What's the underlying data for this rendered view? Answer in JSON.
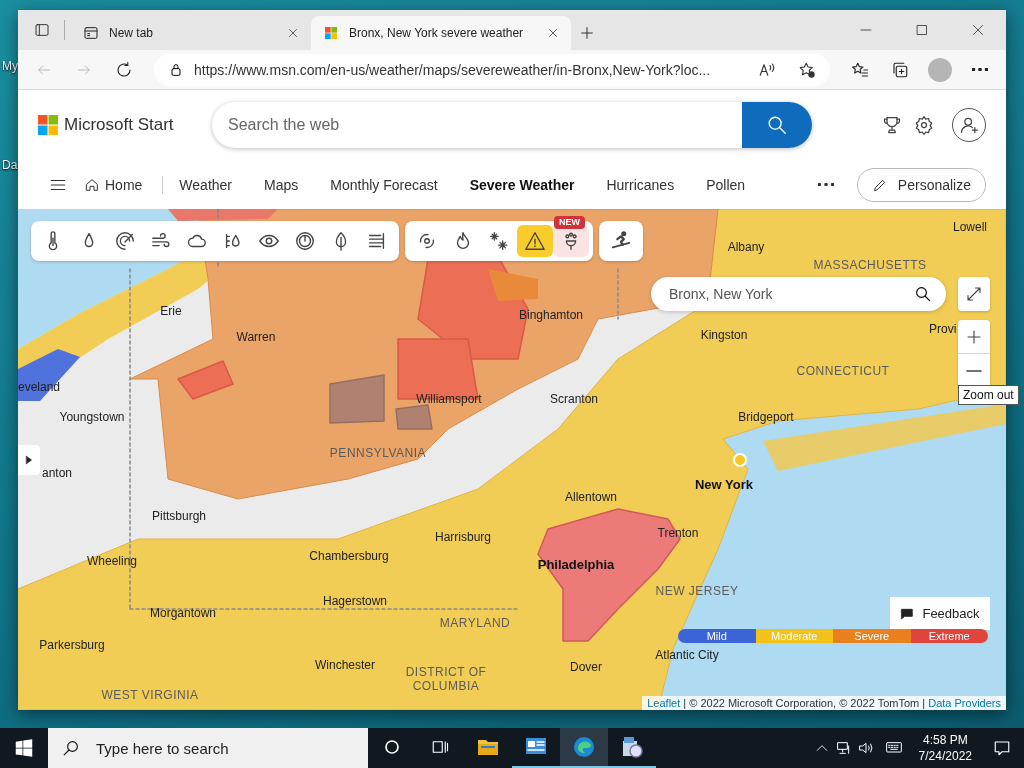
{
  "desktop": {
    "icon_labels": [
      "My",
      "Da"
    ]
  },
  "browser": {
    "tabs": [
      {
        "title": "New tab",
        "selected": false
      },
      {
        "title": "Bronx, New York severe weather",
        "selected": true
      }
    ],
    "url": "https://www.msn.com/en-us/weather/maps/severeweather/in-Bronx,New-York?loc..."
  },
  "site": {
    "logo": "Microsoft Start",
    "search": {
      "placeholder": "Search the web"
    },
    "nav": [
      {
        "label": "Home",
        "kind": "home",
        "selected": false
      },
      {
        "label": "Weather",
        "kind": "link",
        "selected": false
      },
      {
        "label": "Maps",
        "kind": "link",
        "selected": false
      },
      {
        "label": "Monthly Forecast",
        "kind": "link",
        "selected": false
      },
      {
        "label": "Severe Weather",
        "kind": "link",
        "selected": true
      },
      {
        "label": "Hurricanes",
        "kind": "link",
        "selected": false
      },
      {
        "label": "Pollen",
        "kind": "link",
        "selected": false
      }
    ],
    "personalize": "Personalize"
  },
  "map": {
    "layer_groups": [
      [
        {
          "kind": "temperature",
          "selected": false
        },
        {
          "kind": "precipitation",
          "selected": false
        },
        {
          "kind": "radar",
          "selected": false
        },
        {
          "kind": "wind",
          "selected": false
        },
        {
          "kind": "cloud",
          "selected": false
        },
        {
          "kind": "humidity",
          "selected": false
        },
        {
          "kind": "visibility",
          "selected": false
        },
        {
          "kind": "pressure",
          "selected": false
        },
        {
          "kind": "pollen",
          "selected": false
        },
        {
          "kind": "air",
          "selected": false
        }
      ],
      [
        {
          "kind": "hurricane",
          "selected": false
        },
        {
          "kind": "fire",
          "selected": false
        },
        {
          "kind": "snow",
          "selected": false
        },
        {
          "kind": "alert",
          "selected": true
        },
        {
          "kind": "flower",
          "selected": false,
          "badge": "NEW"
        }
      ],
      [
        {
          "kind": "ski",
          "selected": false
        }
      ]
    ],
    "search": {
      "value": "Bronx, New York"
    },
    "tooltip": "Zoom out",
    "feedback": "Feedback",
    "legend": [
      {
        "label": "Mild",
        "color": "#3b64d6"
      },
      {
        "label": "Moderate",
        "color": "#f2c21b"
      },
      {
        "label": "Severe",
        "color": "#e8801e"
      },
      {
        "label": "Extreme",
        "color": "#e0443a"
      }
    ],
    "attribution": {
      "link_1": "Leaflet",
      "text": "| © 2022 Microsoft Corporation, © 2022 TomTom |",
      "link_2": "Data Providers"
    },
    "labels": [
      {
        "text": "Albany",
        "kind": "city"
      },
      {
        "text": "Lowell",
        "kind": "city"
      },
      {
        "text": "MASSACHUSETTS",
        "kind": "state"
      },
      {
        "text": "Erie",
        "kind": "city"
      },
      {
        "text": "Warren",
        "kind": "city"
      },
      {
        "text": "Binghamton",
        "kind": "city"
      },
      {
        "text": "Kingston",
        "kind": "city"
      },
      {
        "text": "Provi",
        "kind": "city"
      },
      {
        "text": "CONNECTICUT",
        "kind": "state"
      },
      {
        "text": "Youngstown",
        "kind": "city"
      },
      {
        "text": "Williamsport",
        "kind": "city"
      },
      {
        "text": "Scranton",
        "kind": "city"
      },
      {
        "text": "Bridgeport",
        "kind": "city"
      },
      {
        "text": "eveland",
        "kind": "city"
      },
      {
        "text": "PENNSYLVANIA",
        "kind": "state"
      },
      {
        "text": "anton",
        "kind": "city"
      },
      {
        "text": "New York",
        "kind": "major"
      },
      {
        "text": "Allentown",
        "kind": "city"
      },
      {
        "text": "Pittsburgh",
        "kind": "city"
      },
      {
        "text": "Harrisburg",
        "kind": "city"
      },
      {
        "text": "Trenton",
        "kind": "city"
      },
      {
        "text": "Chambersburg",
        "kind": "city"
      },
      {
        "text": "Wheeling",
        "kind": "city"
      },
      {
        "text": "Philadelphia",
        "kind": "major"
      },
      {
        "text": "NEW JERSEY",
        "kind": "state"
      },
      {
        "text": "Morgantown",
        "kind": "city"
      },
      {
        "text": "Hagerstown",
        "kind": "city"
      },
      {
        "text": "MARYLAND",
        "kind": "state"
      },
      {
        "text": "Parkersburg",
        "kind": "city"
      },
      {
        "text": "Atlantic City",
        "kind": "city"
      },
      {
        "text": "Winchester",
        "kind": "city"
      },
      {
        "text": "DISTRICT OF COLUMBIA",
        "kind": "state"
      },
      {
        "text": "Dover",
        "kind": "city"
      },
      {
        "text": "WEST VIRGINIA",
        "kind": "state"
      }
    ]
  },
  "taskbar": {
    "search_placeholder": "Type here to search",
    "apps": [
      {
        "kind": "explorer",
        "running": false,
        "selected": false
      },
      {
        "kind": "panel",
        "running": true,
        "selected": false
      },
      {
        "kind": "edge",
        "running": true,
        "selected": true
      },
      {
        "kind": "installer",
        "running": true,
        "selected": false
      }
    ],
    "time": "4:58 PM",
    "date": "7/24/2022"
  }
}
